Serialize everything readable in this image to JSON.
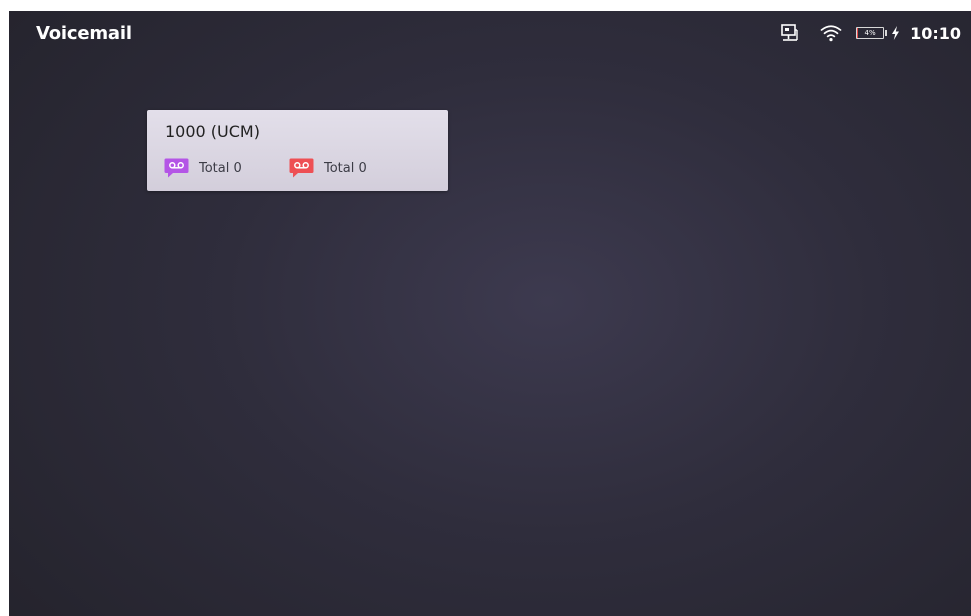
{
  "statusbar": {
    "app_title": "Voicemail",
    "icons": [
      "ethernet-icon",
      "wifi-icon",
      "battery-icon",
      "charging-bolt-icon"
    ],
    "battery": {
      "label": "4%",
      "level": 0.04,
      "color": "#e84b4b"
    },
    "time": "10:10"
  },
  "voicemail_card": {
    "account": "1000 (UCM)",
    "counters": [
      {
        "icon": "voicemail-purple-icon",
        "color": "#b455e6",
        "label": "Total 0"
      },
      {
        "icon": "voicemail-red-icon",
        "color": "#ee4f54",
        "label": "Total 0"
      }
    ]
  }
}
